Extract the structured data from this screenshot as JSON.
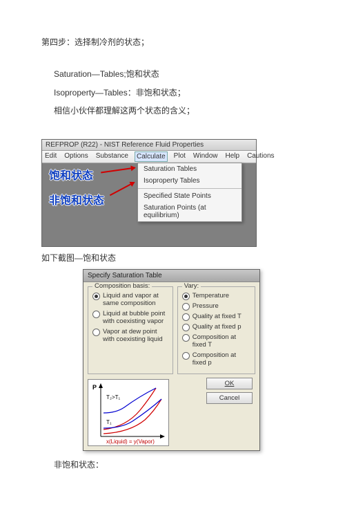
{
  "step_title": "第四步：选择制冷剂的状态；",
  "sat_line": "Saturation—Tables;饱和状态",
  "iso_line": "Isoproperty—Tables：非饱和状态；",
  "note_line": "相信小伙伴都理解这两个状态的含义；",
  "refprop": {
    "title": "REFPROP (R22) - NIST Reference Fluid Properties",
    "menus": [
      "Edit",
      "Options",
      "Substance",
      "Calculate",
      "Plot",
      "Window",
      "Help",
      "Cautions"
    ],
    "items": [
      "Saturation Tables",
      "Isoproperty Tables",
      "Specified State Points",
      "Saturation Points (at equilibrium)"
    ],
    "label_sat": "饱和状态",
    "label_unsat": "非饱和状态"
  },
  "caption1": "如下截图—饱和状态",
  "dialog": {
    "title": "Specify Saturation Table",
    "comp_legend": "Composition basis:",
    "vary_legend": "Vary:",
    "comp_opts": [
      "Liquid and vapor at same composition",
      "Liquid at bubble point with coexisting vapor",
      "Vapor at dew point with coexisting liquid"
    ],
    "vary_opts": [
      "Temperature",
      "Pressure",
      "Quality at fixed T",
      "Quality at fixed p",
      "Composition at fixed T",
      "Composition at fixed p"
    ],
    "ok": "OK",
    "cancel": "Cancel",
    "plot": {
      "yaxis": "P",
      "t2": "T₂>T₁",
      "t1": "T₁",
      "xformula": "x(Liquid) = y(Vapor)"
    }
  },
  "caption2": "非饱和状态："
}
